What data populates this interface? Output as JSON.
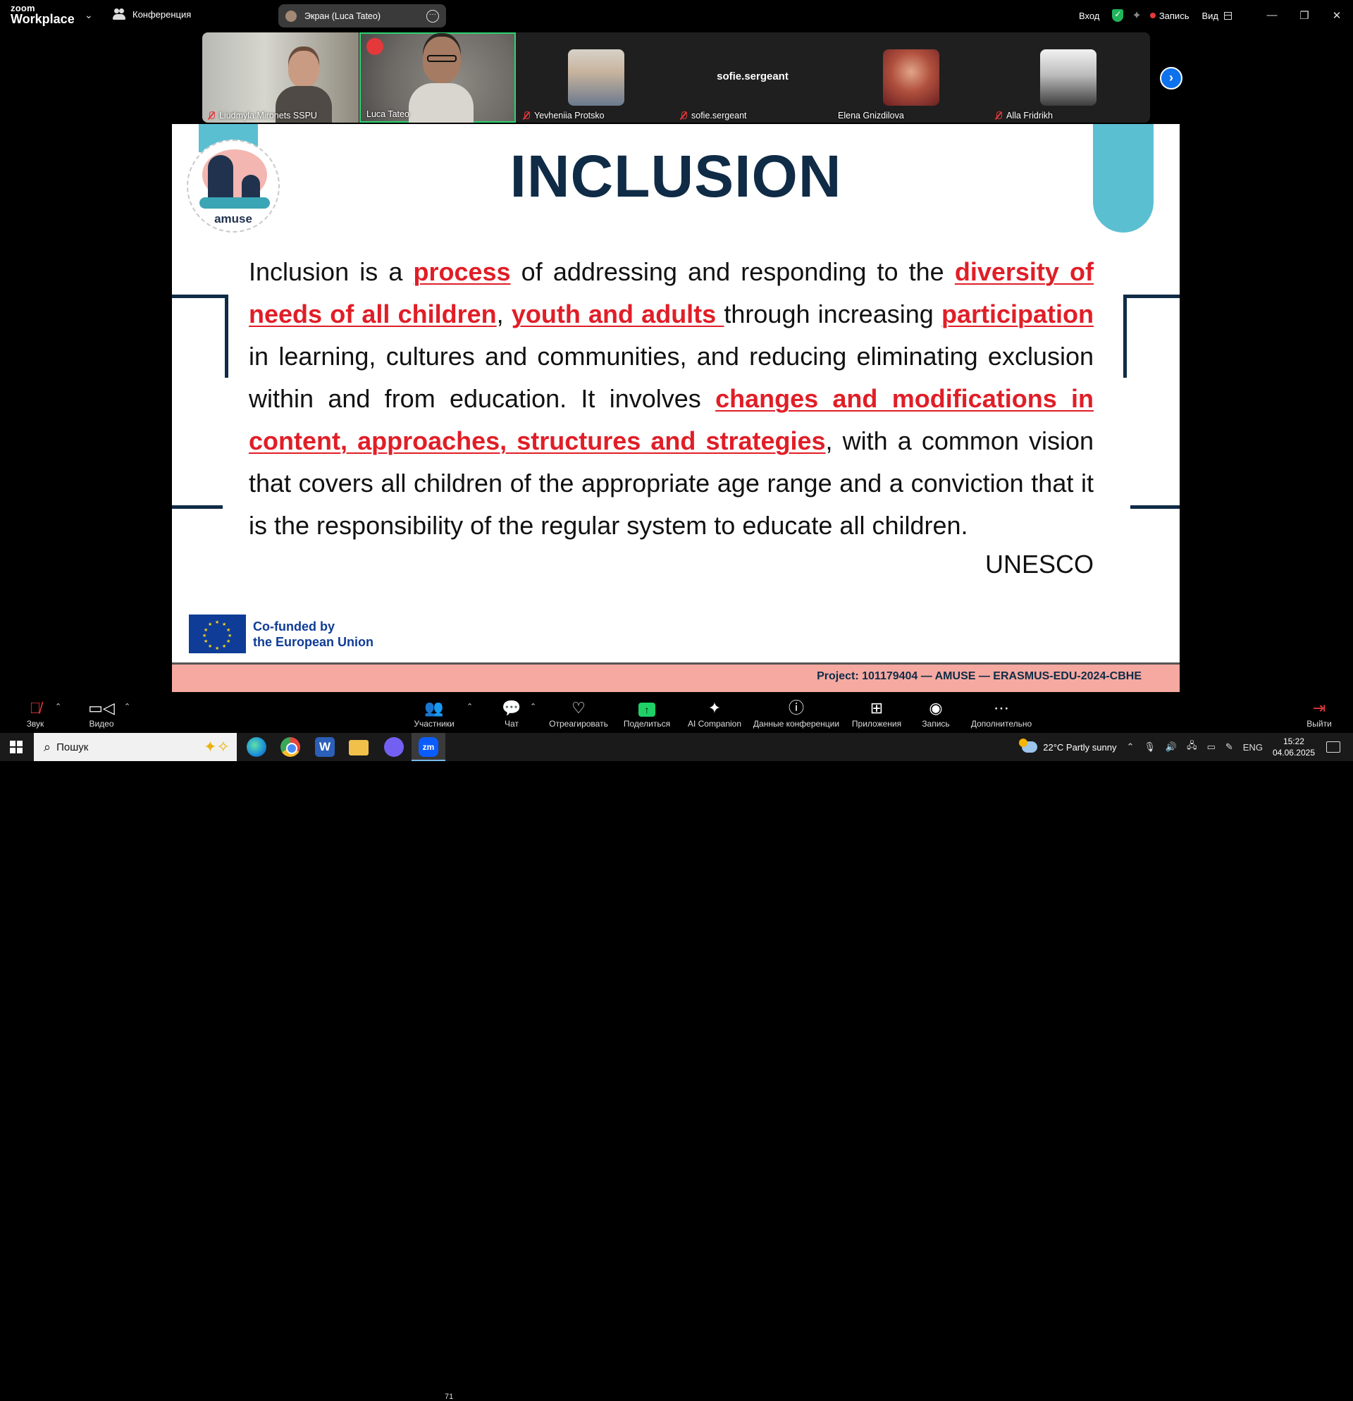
{
  "topbar": {
    "logo_line1": "zoom",
    "logo_line2": "Workplace",
    "meeting_label": "Конференция",
    "share_label": "Экран (Luca Tateo)",
    "signin": "Вход",
    "record_label": "Запись",
    "view_label": "Вид"
  },
  "participants": [
    {
      "name": "Liudmyla Mironets SSPU",
      "muted": true
    },
    {
      "name": "Luca Tateo",
      "muted": false,
      "speaking": true
    },
    {
      "name": "Yevheniia Protsko",
      "muted": true
    },
    {
      "name": "sofie.sergeant",
      "muted": true,
      "display_name": "sofie.sergeant"
    },
    {
      "name": "Elena Gnizdilova",
      "muted": false
    },
    {
      "name": "Alla Fridrikh",
      "muted": true
    }
  ],
  "slide": {
    "logo_word": "amuse",
    "title": "INCLUSION",
    "body": {
      "p1": "Inclusion is a ",
      "h1": "process",
      "p2": " of addressing and responding to the ",
      "h2": "diversity of needs of all children",
      "p3": ", ",
      "h3": "youth and adults ",
      "p4": "through increasing ",
      "h4": "participation",
      "p5": " in learning, cultures and communities, and reducing eliminating exclusion within and from education. It involves ",
      "h5": "changes and modifications in content, approaches, structures and strategies",
      "p6": ", with a common vision that covers all children of the appropriate age range and a conviction that it is the responsibility of the regular system to educate all children."
    },
    "source": "UNESCO",
    "eu_line1": "Co-funded by",
    "eu_line2": "the European Union",
    "footer": "Project: 101179404 — AMUSE — ERASMUS-EDU-2024-CBHE"
  },
  "toolbar": {
    "audio": "Звук",
    "video": "Видео",
    "participants": "Участники",
    "participants_count": "71",
    "chat": "Чат",
    "react": "Отреагировать",
    "share": "Поделиться",
    "ai": "AI Companion",
    "info": "Данные конференции",
    "apps": "Приложения",
    "record": "Запись",
    "more": "Дополнительно",
    "leave": "Выйти"
  },
  "taskbar": {
    "search_placeholder": "Пошук",
    "word_letter": "W",
    "zoom_letters": "zm",
    "weather": "22°C  Partly sunny",
    "lang": "ENG",
    "time": "15:22",
    "date": "04.06.2025"
  },
  "colors": {
    "accent_blue": "#0e72ed",
    "speaking_green": "#2dd36f",
    "slide_title": "#0f2b46",
    "highlight_red": "#e01e27",
    "footer_pink": "#f5a9a1"
  }
}
